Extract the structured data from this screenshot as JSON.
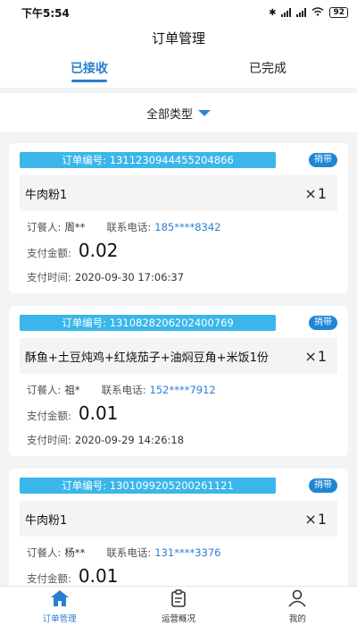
{
  "status": {
    "time": "下午5:54",
    "signal1": "HD",
    "signal2": "HD",
    "battery": "92"
  },
  "title": "订单管理",
  "tabs": [
    {
      "label": "已接收",
      "active": true
    },
    {
      "label": "已完成",
      "active": false
    }
  ],
  "filter": {
    "label": "全部类型"
  },
  "labels": {
    "orderer": "订餐人:",
    "phone": "联系电话:",
    "amount": "支付金额:",
    "time": "支付时间:"
  },
  "orders": [
    {
      "order_no": "订单编号:  1311230944455204866",
      "tag": "捎带",
      "items": "牛肉粉1",
      "qty": "1",
      "orderer": "周**",
      "phone": "185****8342",
      "amount": "0.02",
      "time": "2020-09-30 17:06:37"
    },
    {
      "order_no": "订单编号:  1310828206202400769",
      "tag": "捎带",
      "items": "酥鱼+土豆炖鸡+红烧茄子+油焖豆角+米饭1份",
      "qty": "1",
      "orderer": "祖*",
      "phone": "152****7912",
      "amount": "0.01",
      "time": "2020-09-29 14:26:18"
    },
    {
      "order_no": "订单编号:  1301099205200261121",
      "tag": "捎带",
      "items": "牛肉粉1",
      "qty": "1",
      "orderer": "杨**",
      "phone": "131****3376",
      "amount": "0.01",
      "time": ""
    }
  ],
  "nav": [
    {
      "label": "订单管理",
      "icon": "home-icon",
      "active": true
    },
    {
      "label": "运营概况",
      "icon": "clipboard-icon",
      "active": false
    },
    {
      "label": "我的",
      "icon": "user-icon",
      "active": false
    }
  ],
  "colors": {
    "accent": "#2b7fd0",
    "order_no_bg": "#3ab6ea",
    "tag_bg": "#1f86d4"
  }
}
